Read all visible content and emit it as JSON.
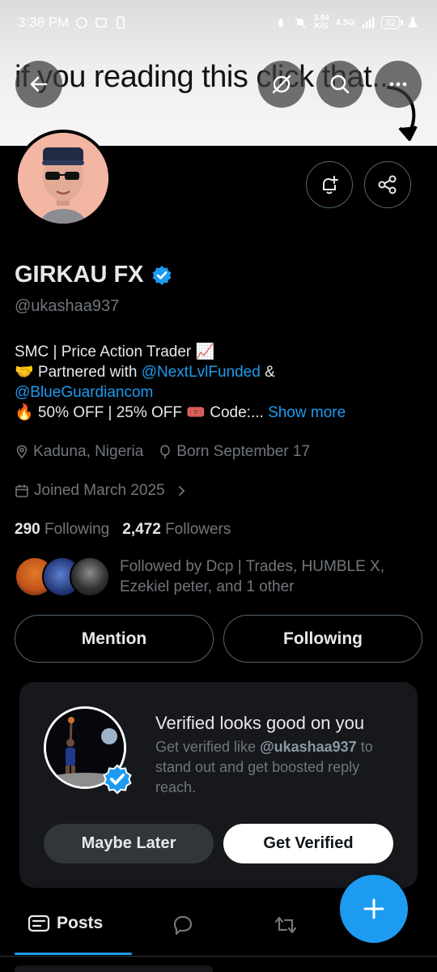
{
  "status_bar": {
    "time": "3:38 PM",
    "net_speed_value": "3.94",
    "net_speed_unit": "K/S",
    "net_type": "4.5G",
    "battery": "32"
  },
  "banner": {
    "text": "if you reading this click that..."
  },
  "profile": {
    "display_name": "GIRKAU FX",
    "handle": "@ukashaa937",
    "bio_line1": "SMC | Price Action Trader 📈",
    "bio_line2_prefix": "🤝 Partnered with ",
    "bio_link1": "@NextLvlFunded",
    "bio_line2_suffix": " &",
    "bio_link2": "@BlueGuardiancom",
    "bio_line3": "🔥 50% OFF | 25% OFF 🎟️ Code:... ",
    "show_more": "Show more",
    "location": "Kaduna, Nigeria",
    "birthday": "Born September 17",
    "joined": "Joined March 2025",
    "following_count": "290",
    "following_label": "Following",
    "followers_count": "2,472",
    "followers_label": "Followers",
    "followed_by": "Followed by Dcp | Trades, HUMBLE X, Ezekiel peter, and 1 other"
  },
  "actions": {
    "mention": "Mention",
    "following": "Following"
  },
  "verified_card": {
    "title": "Verified looks good on you",
    "desc_prefix": "Get verified like ",
    "desc_handle": "@ukashaa937",
    "desc_suffix": " to stand out and get boosted reply reach.",
    "maybe_later": "Maybe Later",
    "get_verified": "Get Verified"
  },
  "tabs": {
    "posts": "Posts"
  },
  "colors": {
    "accent": "#1d9bf0",
    "background": "#000000",
    "muted_text": "#71767b"
  }
}
